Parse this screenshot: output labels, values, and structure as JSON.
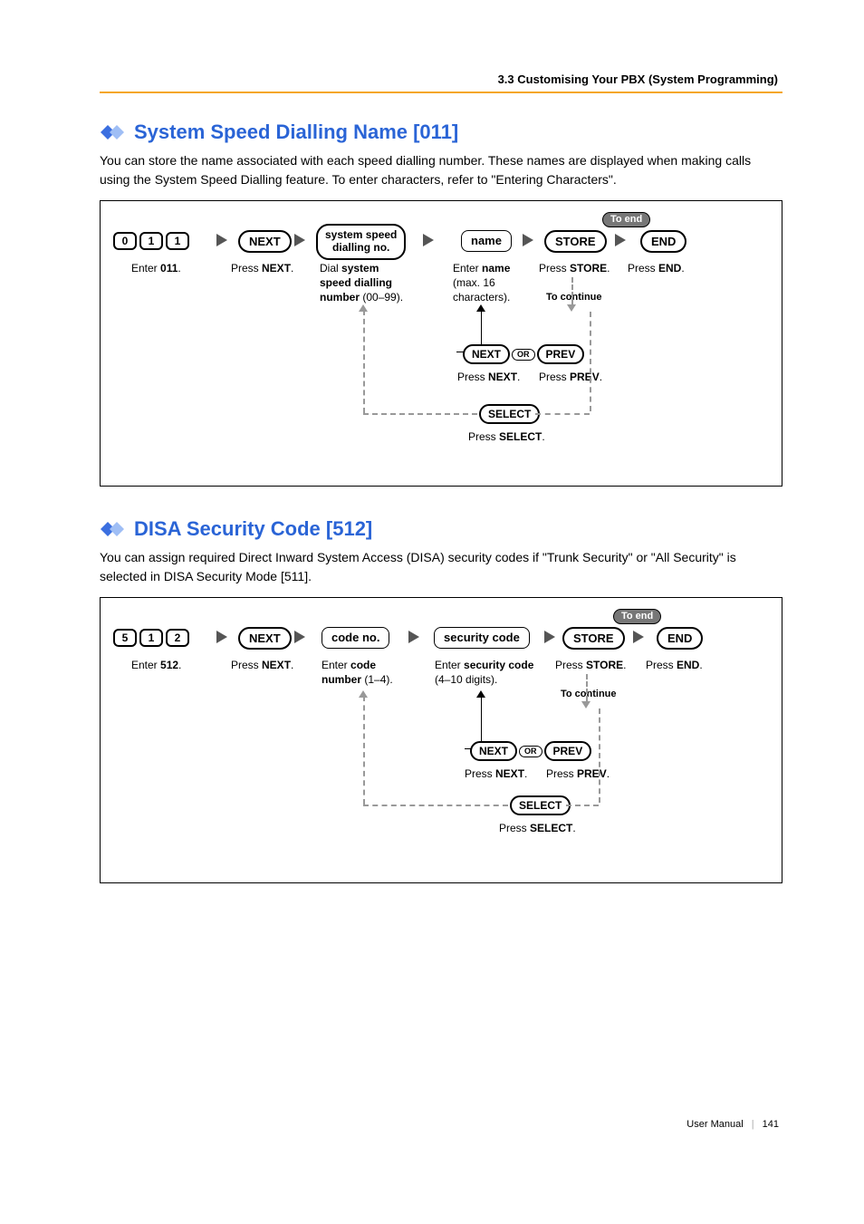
{
  "header": "3.3 Customising Your PBX (System Programming)",
  "section1": {
    "title": "System Speed Dialling Name [011]",
    "desc": "You can store the name associated with each speed dialling number. These names are displayed when making calls using the System Speed Dialling feature. To enter characters, refer to \"Entering Characters\".",
    "keys": [
      "0",
      "1",
      "1"
    ],
    "step1_desc_pre": "Enter ",
    "step1_desc_bold": "011",
    "step1_desc_post": ".",
    "step2_btn": "NEXT",
    "step2_desc_pre": "Press ",
    "step2_desc_bold": "NEXT",
    "step2_desc_post": ".",
    "step3_box_l1": "system speed",
    "step3_box_l2": "dialling no.",
    "step3_desc_l1_a": "Dial ",
    "step3_desc_l1_b": "system",
    "step3_desc_l2": "speed dialling",
    "step3_desc_l3_a": "number",
    "step3_desc_l3_b": " (00–99).",
    "step4_box": "name",
    "step4_desc_l1_a": "Enter ",
    "step4_desc_l1_b": "name",
    "step4_desc_l2": "(max. 16",
    "step4_desc_l3": "characters).",
    "step5_btn": "STORE",
    "step5_desc_pre": "Press ",
    "step5_desc_bold": "STORE",
    "step5_desc_post": ".",
    "step6_btn": "END",
    "step6_desc_pre": "Press ",
    "step6_desc_bold": "END",
    "step6_desc_post": ".",
    "to_end": "To end",
    "to_continue": "To continue",
    "next_btn": "NEXT",
    "prev_btn": "PREV",
    "or_label": "OR",
    "next_desc_pre": "Press ",
    "next_desc_bold": "NEXT",
    "next_desc_post": ".",
    "prev_desc_pre": "Press ",
    "prev_desc_bold": "PREV",
    "prev_desc_post": ".",
    "select_btn": "SELECT",
    "select_desc_pre": "Press ",
    "select_desc_bold": "SELECT",
    "select_desc_post": "."
  },
  "section2": {
    "title": "DISA Security Code [512]",
    "desc": "You can assign required Direct Inward System Access (DISA) security codes if \"Trunk Security\" or \"All Security\" is selected in DISA Security Mode [511].",
    "keys": [
      "5",
      "1",
      "2"
    ],
    "step1_desc_pre": "Enter ",
    "step1_desc_bold": "512",
    "step1_desc_post": ".",
    "step2_btn": "NEXT",
    "step2_desc_pre": "Press ",
    "step2_desc_bold": "NEXT",
    "step2_desc_post": ".",
    "step3_box": "code no.",
    "step3_desc_l1_a": "Enter ",
    "step3_desc_l1_b": "code",
    "step3_desc_l2_a": "number",
    "step3_desc_l2_b": " (1–4).",
    "step4_box": "security code",
    "step4_desc_l1_a": "Enter ",
    "step4_desc_l1_b": "security code",
    "step4_desc_l2": "(4–10 digits).",
    "step5_btn": "STORE",
    "step5_desc_pre": "Press ",
    "step5_desc_bold": "STORE",
    "step5_desc_post": ".",
    "step6_btn": "END",
    "step6_desc_pre": "Press ",
    "step6_desc_bold": "END",
    "step6_desc_post": ".",
    "to_end": "To end",
    "to_continue": "To continue",
    "next_btn": "NEXT",
    "prev_btn": "PREV",
    "or_label": "OR",
    "next_desc_pre": "Press ",
    "next_desc_bold": "NEXT",
    "next_desc_post": ".",
    "prev_desc_pre": "Press ",
    "prev_desc_bold": "PREV",
    "prev_desc_post": ".",
    "select_btn": "SELECT",
    "select_desc_pre": "Press ",
    "select_desc_bold": "SELECT",
    "select_desc_post": "."
  },
  "footer": {
    "label": "User Manual",
    "page": "141"
  }
}
